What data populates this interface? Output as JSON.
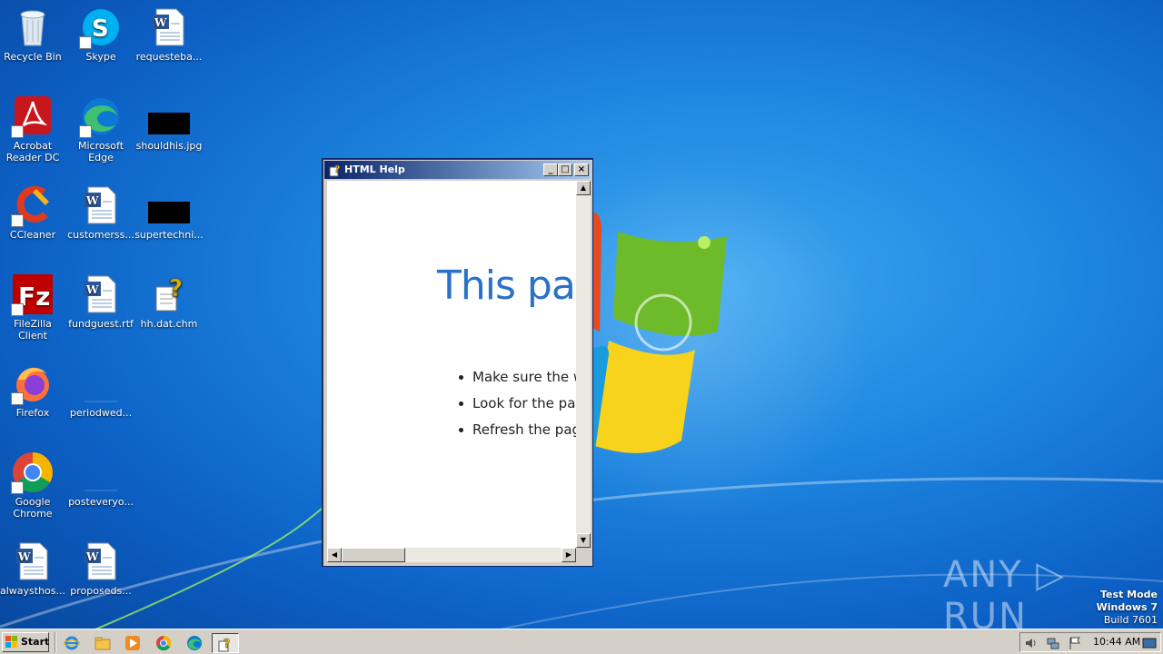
{
  "desktop_icons": [
    {
      "label": "Recycle Bin",
      "icon": "recycle-bin-icon"
    },
    {
      "label": "Skype",
      "icon": "skype-icon"
    },
    {
      "label": "requesteba...",
      "icon": "word-document-icon"
    },
    {
      "label": "Acrobat Reader DC",
      "icon": "acrobat-icon"
    },
    {
      "label": "Microsoft Edge",
      "icon": "edge-icon"
    },
    {
      "label": "shouldhis.jpg",
      "icon": "image-file-icon"
    },
    {
      "label": "CCleaner",
      "icon": "ccleaner-icon"
    },
    {
      "label": "customerss...",
      "icon": "word-document-icon"
    },
    {
      "label": "supertechni...",
      "icon": "image-file-icon"
    },
    {
      "label": "FileZilla Client",
      "icon": "filezilla-icon"
    },
    {
      "label": "fundguest.rtf",
      "icon": "word-document-icon"
    },
    {
      "label": "hh.dat.chm",
      "icon": "chm-help-icon"
    },
    {
      "label": "Firefox",
      "icon": "firefox-icon"
    },
    {
      "label": "periodwed...",
      "icon": "blank-file-icon"
    },
    {
      "label": "Google Chrome",
      "icon": "chrome-icon"
    },
    {
      "label": "posteveryo...",
      "icon": "blank-file-icon"
    },
    {
      "label": "alwaysthos...",
      "icon": "word-document-icon"
    },
    {
      "label": "proposeds...",
      "icon": "word-document-icon"
    }
  ],
  "help_window": {
    "title": "HTML Help",
    "heading": "This pa",
    "bullets": [
      "Make sure the we",
      "Look for the page",
      "Refresh the page"
    ],
    "min_glyph": "_",
    "max_glyph": "□",
    "close_glyph": "×",
    "scroll_up": "▲",
    "scroll_down": "▼",
    "scroll_left": "◀",
    "scroll_right": "▶"
  },
  "watermark": {
    "text": "ANY ▷ RUN",
    "line1": "Test Mode",
    "line2": "Windows 7",
    "line3": "Build 7601"
  },
  "taskbar": {
    "start_label": "Start",
    "clock": "10:44 AM",
    "apps": [
      "internet-explorer-icon",
      "file-explorer-icon",
      "media-player-icon",
      "chrome-icon",
      "edge-icon",
      "html-help-icon"
    ]
  },
  "colors": {
    "desktop_blue": "#1d86e0",
    "titlebar_start": "#0a246a",
    "titlebar_end": "#a6caf0",
    "heading_blue": "#2a72c8"
  }
}
